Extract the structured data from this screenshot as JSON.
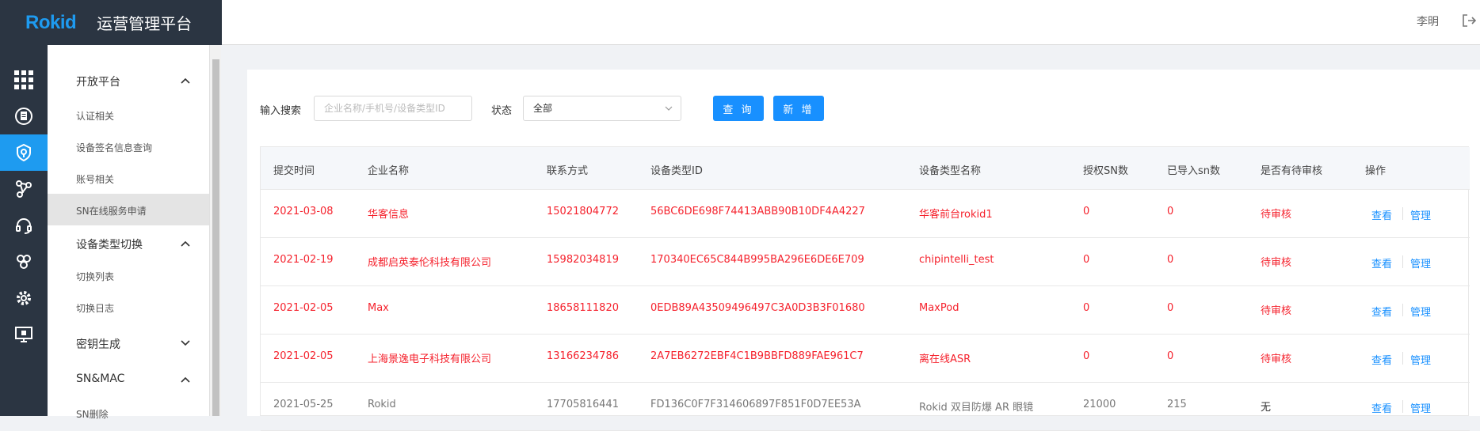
{
  "header": {
    "logo": "Rokid",
    "app_title": "运营管理平台",
    "user_name": "李明"
  },
  "menu": {
    "groups": [
      {
        "label": "开放平台",
        "items": [
          "认证相关",
          "设备签名信息查询",
          "账号相关",
          "SN在线服务申请"
        ]
      },
      {
        "label": "设备类型切换",
        "items": [
          "切换列表",
          "切换日志"
        ]
      },
      {
        "label": "密钥生成",
        "items": []
      },
      {
        "label": "SN&MAC",
        "items": [
          "SN删除"
        ]
      }
    ],
    "selected": "SN在线服务申请"
  },
  "filter": {
    "search_label": "输入搜索",
    "search_placeholder": "企业名称/手机号/设备类型ID",
    "status_label": "状态",
    "status_value": "全部",
    "query_button": "查 询",
    "add_button": "新 增"
  },
  "table": {
    "columns": [
      "提交时间",
      "企业名称",
      "联系方式",
      "设备类型ID",
      "设备类型名称",
      "授权SN数",
      "已导入sn数",
      "是否有待审核",
      "操作"
    ],
    "actions": {
      "view": "查看",
      "manage": "管理"
    },
    "rows": [
      {
        "time": "2021-03-08",
        "company": "华客信息",
        "contact": "15021804772",
        "type_id": "56BC6DE698F74413ABB90B10DF4A4227",
        "type_name": "华客前台rokid1",
        "auth_sn": "0",
        "imported_sn": "0",
        "pending": "待审核"
      },
      {
        "time": "2021-02-19",
        "company": "成都启英泰伦科技有限公司",
        "contact": "15982034819",
        "type_id": "170340EC65C844B995BA296E6DE6E709",
        "type_name": "chipintelli_test",
        "auth_sn": "0",
        "imported_sn": "0",
        "pending": "待审核"
      },
      {
        "time": "2021-02-05",
        "company": "Max",
        "contact": "18658111820",
        "type_id": "0EDB89A43509496497C3A0D3B3F01680",
        "type_name": "MaxPod",
        "auth_sn": "0",
        "imported_sn": "0",
        "pending": "待审核"
      },
      {
        "time": "2021-02-05",
        "company": "上海景逸电子科技有限公司",
        "contact": "13166234786",
        "type_id": "2A7EB6272EBF4C1B9BBFD889FAE961C7",
        "type_name": "离在线ASR",
        "auth_sn": "0",
        "imported_sn": "0",
        "pending": "待审核"
      },
      {
        "time": "2021-05-25",
        "company": "Rokid",
        "contact": "17705816441",
        "type_id": "FD136C0F7F314606897F851F0D7EE53A",
        "type_name": "Rokid 双目防爆 AR 眼镜",
        "auth_sn": "21000",
        "imported_sn": "215",
        "pending": "无"
      }
    ]
  },
  "colors": {
    "brand_dark": "#2b3542",
    "accent": "#1e9bf0",
    "button": "#1890ff",
    "pending_red": "#f5222d"
  },
  "icons": [
    "grid-icon",
    "document-icon",
    "shield-icon",
    "share-nodes-icon",
    "headset-icon",
    "molecule-icon",
    "gear-icon",
    "monitor-icon",
    "logout-icon",
    "chevron-up-icon",
    "chevron-down-icon"
  ]
}
